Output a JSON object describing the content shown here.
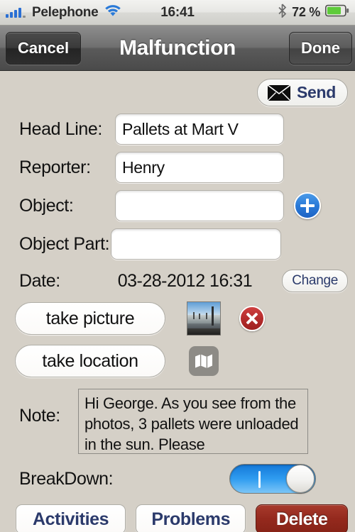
{
  "status_bar": {
    "carrier": "Pelephone",
    "wifi_icon": "wifi-icon",
    "time": "16:41",
    "bluetooth_icon": "bluetooth-icon",
    "battery_percent": "72 %",
    "battery_level": 72,
    "signal_bars_filled": 4,
    "signal_bars_total": 5
  },
  "nav_bar": {
    "cancel_label": "Cancel",
    "title": "Malfunction",
    "done_label": "Done"
  },
  "toolbar": {
    "send_label": "Send",
    "send_icon": "envelope-icon"
  },
  "form": {
    "head_line": {
      "label": "Head Line:",
      "value": "Pallets at Mart V",
      "placeholder": ""
    },
    "reporter": {
      "label": "Reporter:",
      "value": "Henry",
      "placeholder": ""
    },
    "object": {
      "label": "Object:",
      "value": "",
      "placeholder": "",
      "add_icon": "plus-circle-icon"
    },
    "object_part": {
      "label": "Object Part:",
      "value": "",
      "placeholder": ""
    },
    "date": {
      "label": "Date:",
      "value": "03-28-2012 16:31",
      "change_label": "Change"
    },
    "picture": {
      "button_label": "take picture",
      "thumbnail_name": "photo-thumbnail",
      "delete_icon": "delete-circle-icon"
    },
    "location": {
      "button_label": "take location",
      "map_icon": "map-icon"
    },
    "note": {
      "label": "Note:",
      "value": "Hi George. As you see from the photos, 3 pallets were unloaded in the sun. Please",
      "placeholder": ""
    },
    "breakdown": {
      "label": "BreakDown:",
      "state": "on"
    }
  },
  "bottom_bar": {
    "activities_label": "Activities",
    "problems_label": "Problems",
    "delete_label": "Delete"
  },
  "colors": {
    "page_background": "#d5d0c7",
    "accent_blue": "#2b3a6b",
    "toggle_on": "#2f9cf0",
    "danger_red": "#94291d",
    "plus_blue": "#2a7ad8"
  }
}
